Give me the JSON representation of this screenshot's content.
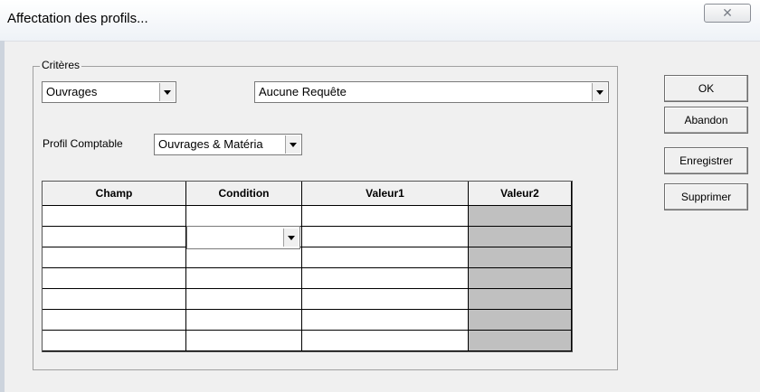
{
  "window": {
    "title": "Affectation des profils...",
    "close_glyph": "✕"
  },
  "criteria": {
    "group_label": "Critères",
    "type_combo": {
      "value": "Ouvrages"
    },
    "query_combo": {
      "value": "Aucune Requête"
    },
    "profile_label": "Profil Comptable",
    "profile_combo": {
      "value": "Ouvrages & Matéria"
    }
  },
  "grid": {
    "columns": [
      "Champ",
      "Condition",
      "Valeur1",
      "Valeur2"
    ],
    "row_count": 7,
    "rows": [
      [
        "",
        "",
        "",
        ""
      ],
      [
        "",
        "",
        "",
        ""
      ],
      [
        "",
        "",
        "",
        ""
      ],
      [
        "",
        "",
        "",
        ""
      ],
      [
        "",
        "",
        "",
        ""
      ],
      [
        "",
        "",
        "",
        ""
      ],
      [
        "",
        "",
        "",
        ""
      ]
    ]
  },
  "buttons": {
    "ok": "OK",
    "abandon": "Abandon",
    "enregistrer": "Enregistrer",
    "supprimer": "Supprimer"
  }
}
